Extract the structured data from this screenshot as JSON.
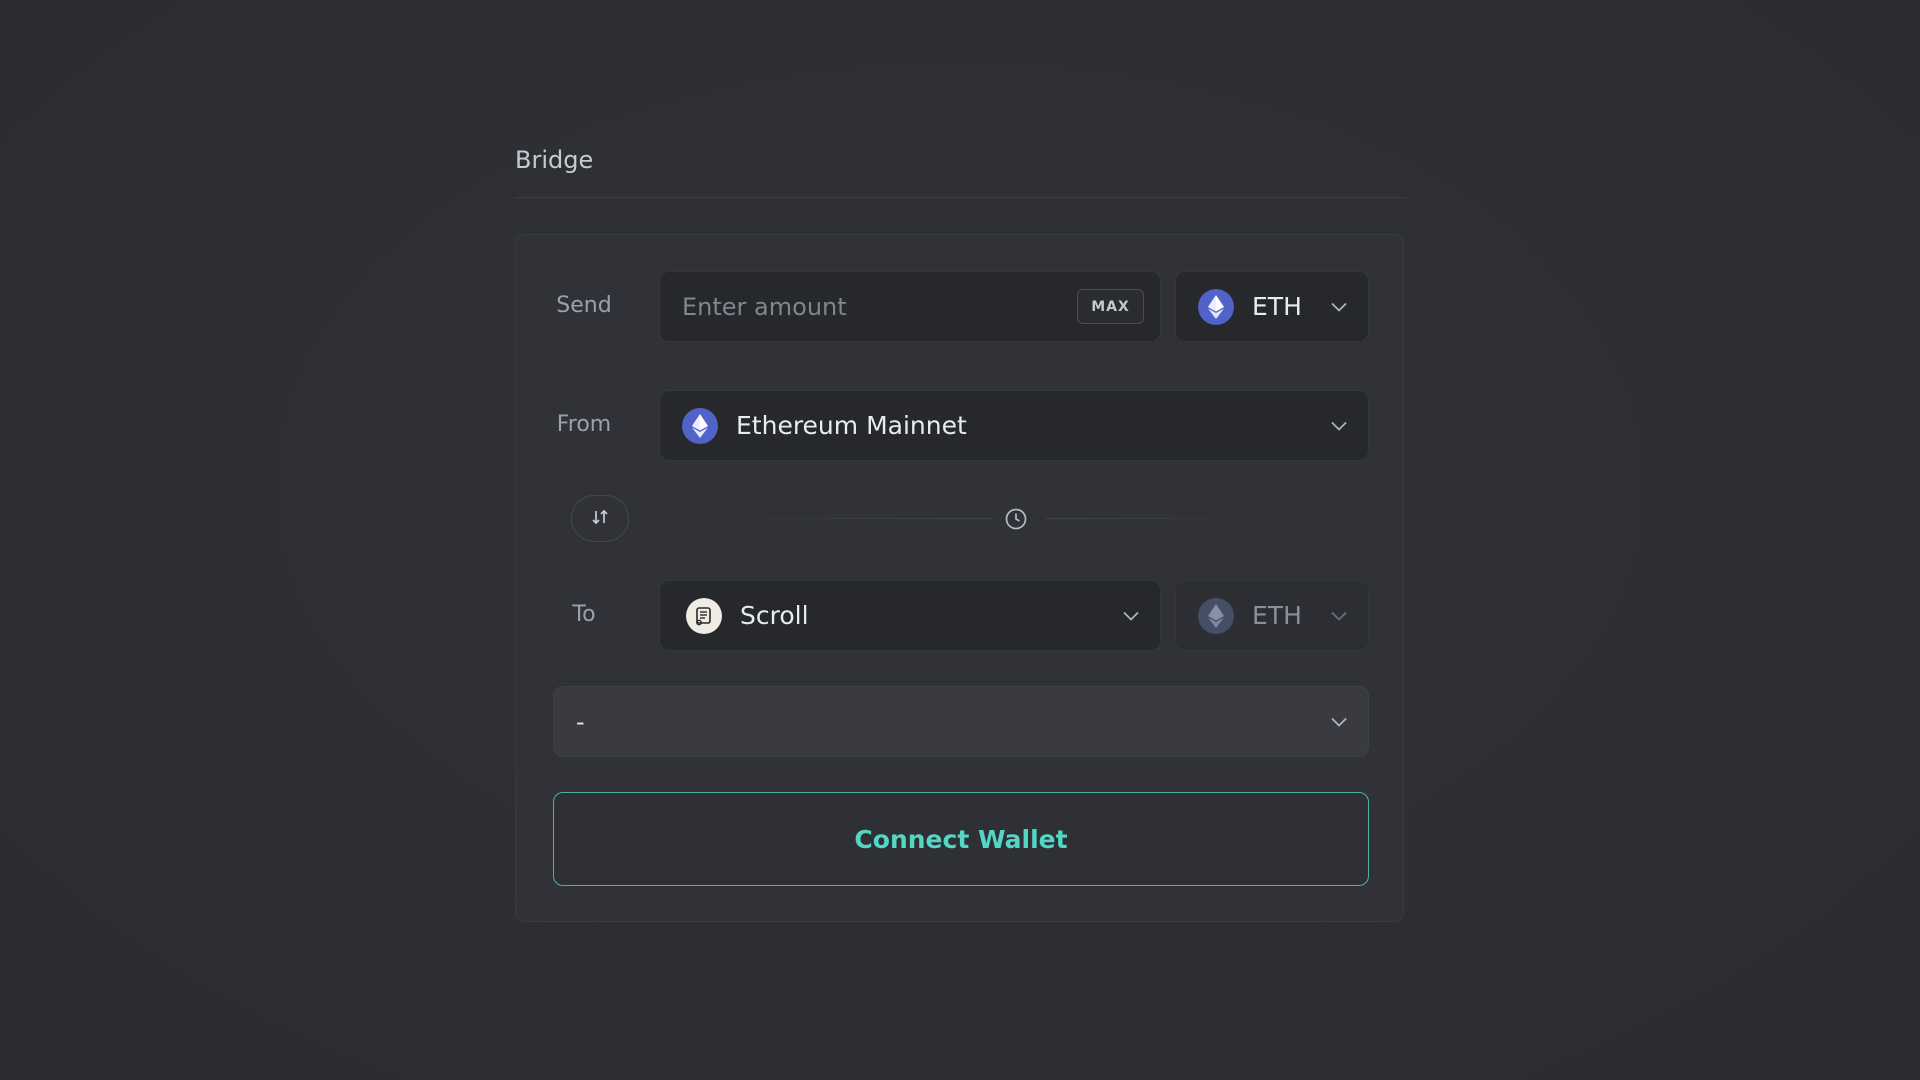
{
  "header": {
    "title": "Bridge"
  },
  "form": {
    "send": {
      "label": "Send",
      "amount_placeholder": "Enter amount",
      "amount_value": "",
      "max_label": "MAX",
      "token": "ETH",
      "token_icon": "ethereum-icon"
    },
    "from": {
      "label": "From",
      "network": "Ethereum Mainnet",
      "network_icon": "ethereum-icon"
    },
    "swap": {
      "icon": "swap-arrows-icon",
      "timer_icon": "clock-icon"
    },
    "to": {
      "label": "To",
      "network": "Scroll",
      "network_icon": "scroll-icon",
      "token": "ETH",
      "token_icon": "ethereum-icon"
    },
    "route": {
      "value": "-"
    },
    "connect_label": "Connect Wallet"
  },
  "colors": {
    "accent": "#53d6c4",
    "ethereum": "#5162c9",
    "background": "#2e3035"
  }
}
